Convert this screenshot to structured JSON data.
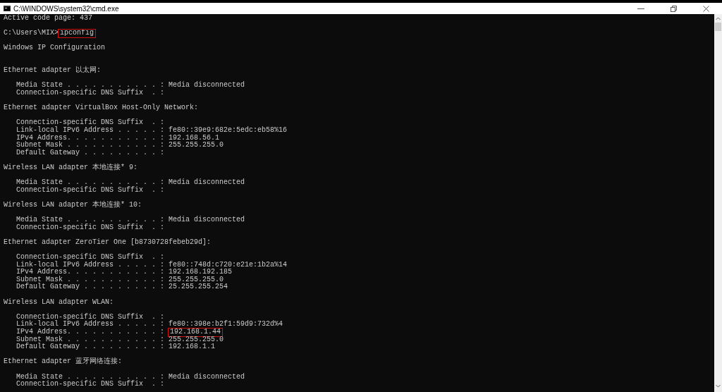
{
  "window": {
    "title": "C:\\WINDOWS\\system32\\cmd.exe"
  },
  "lines": [
    {
      "kind": "text",
      "parts": [
        {
          "text": "Active code page: 437",
          "boxed": false
        }
      ]
    },
    {
      "kind": "blank"
    },
    {
      "kind": "text",
      "parts": [
        {
          "text": "C:\\Users\\MIX>",
          "boxed": false
        },
        {
          "text": "ipconfig",
          "boxed": true
        }
      ]
    },
    {
      "kind": "blank"
    },
    {
      "kind": "text",
      "parts": [
        {
          "text": "Windows IP Configuration",
          "boxed": false
        }
      ]
    },
    {
      "kind": "blank"
    },
    {
      "kind": "blank"
    },
    {
      "kind": "text",
      "parts": [
        {
          "text": "Ethernet adapter 以太网:",
          "boxed": false
        }
      ]
    },
    {
      "kind": "blank"
    },
    {
      "kind": "text",
      "parts": [
        {
          "text": "   Media State . . . . . . . . . . . : Media disconnected",
          "boxed": false
        }
      ]
    },
    {
      "kind": "text",
      "parts": [
        {
          "text": "   Connection-specific DNS Suffix  . :",
          "boxed": false
        }
      ]
    },
    {
      "kind": "blank"
    },
    {
      "kind": "text",
      "parts": [
        {
          "text": "Ethernet adapter VirtualBox Host-Only Network:",
          "boxed": false
        }
      ]
    },
    {
      "kind": "blank"
    },
    {
      "kind": "text",
      "parts": [
        {
          "text": "   Connection-specific DNS Suffix  . :",
          "boxed": false
        }
      ]
    },
    {
      "kind": "text",
      "parts": [
        {
          "text": "   Link-local IPv6 Address . . . . . : fe80::39e9:682e:5edc:eb58%16",
          "boxed": false
        }
      ]
    },
    {
      "kind": "text",
      "parts": [
        {
          "text": "   IPv4 Address. . . . . . . . . . . : 192.168.56.1",
          "boxed": false
        }
      ]
    },
    {
      "kind": "text",
      "parts": [
        {
          "text": "   Subnet Mask . . . . . . . . . . . : 255.255.255.0",
          "boxed": false
        }
      ]
    },
    {
      "kind": "text",
      "parts": [
        {
          "text": "   Default Gateway . . . . . . . . . :",
          "boxed": false
        }
      ]
    },
    {
      "kind": "blank"
    },
    {
      "kind": "text",
      "parts": [
        {
          "text": "Wireless LAN adapter 本地连接* 9:",
          "boxed": false
        }
      ]
    },
    {
      "kind": "blank"
    },
    {
      "kind": "text",
      "parts": [
        {
          "text": "   Media State . . . . . . . . . . . : Media disconnected",
          "boxed": false
        }
      ]
    },
    {
      "kind": "text",
      "parts": [
        {
          "text": "   Connection-specific DNS Suffix  . :",
          "boxed": false
        }
      ]
    },
    {
      "kind": "blank"
    },
    {
      "kind": "text",
      "parts": [
        {
          "text": "Wireless LAN adapter 本地连接* 10:",
          "boxed": false
        }
      ]
    },
    {
      "kind": "blank"
    },
    {
      "kind": "text",
      "parts": [
        {
          "text": "   Media State . . . . . . . . . . . : Media disconnected",
          "boxed": false
        }
      ]
    },
    {
      "kind": "text",
      "parts": [
        {
          "text": "   Connection-specific DNS Suffix  . :",
          "boxed": false
        }
      ]
    },
    {
      "kind": "blank"
    },
    {
      "kind": "text",
      "parts": [
        {
          "text": "Ethernet adapter ZeroTier One [b8730728febeb29d]:",
          "boxed": false
        }
      ]
    },
    {
      "kind": "blank"
    },
    {
      "kind": "text",
      "parts": [
        {
          "text": "   Connection-specific DNS Suffix  . :",
          "boxed": false
        }
      ]
    },
    {
      "kind": "text",
      "parts": [
        {
          "text": "   Link-local IPv6 Address . . . . . : fe80::748d:c720:e21e:1b2a%14",
          "boxed": false
        }
      ]
    },
    {
      "kind": "text",
      "parts": [
        {
          "text": "   IPv4 Address. . . . . . . . . . . : 192.168.192.185",
          "boxed": false
        }
      ]
    },
    {
      "kind": "text",
      "parts": [
        {
          "text": "   Subnet Mask . . . . . . . . . . . : 255.255.255.0",
          "boxed": false
        }
      ]
    },
    {
      "kind": "text",
      "parts": [
        {
          "text": "   Default Gateway . . . . . . . . . : 25.255.255.254",
          "boxed": false
        }
      ]
    },
    {
      "kind": "blank"
    },
    {
      "kind": "text",
      "parts": [
        {
          "text": "Wireless LAN adapter WLAN:",
          "boxed": false
        }
      ]
    },
    {
      "kind": "blank"
    },
    {
      "kind": "text",
      "parts": [
        {
          "text": "   Connection-specific DNS Suffix  . :",
          "boxed": false
        }
      ]
    },
    {
      "kind": "text",
      "parts": [
        {
          "text": "   Link-local IPv6 Address . . . . . : fe80::398e:b2f1:59d9:732d%4",
          "boxed": false
        }
      ]
    },
    {
      "kind": "text",
      "parts": [
        {
          "text": "   IPv4 Address. . . . . . . . . . . : ",
          "boxed": false
        },
        {
          "text": "192.168.1.44",
          "boxed": true
        }
      ]
    },
    {
      "kind": "text",
      "parts": [
        {
          "text": "   Subnet Mask . . . . . . . . . . . : 255.255.255.0",
          "boxed": false
        }
      ]
    },
    {
      "kind": "text",
      "parts": [
        {
          "text": "   Default Gateway . . . . . . . . . : 192.168.1.1",
          "boxed": false
        }
      ]
    },
    {
      "kind": "blank"
    },
    {
      "kind": "text",
      "parts": [
        {
          "text": "Ethernet adapter 蓝牙网络连接:",
          "boxed": false
        }
      ]
    },
    {
      "kind": "blank"
    },
    {
      "kind": "text",
      "parts": [
        {
          "text": "   Media State . . . . . . . . . . . : Media disconnected",
          "boxed": false
        }
      ]
    },
    {
      "kind": "text",
      "parts": [
        {
          "text": "   Connection-specific DNS Suffix  . :",
          "boxed": false
        }
      ]
    }
  ]
}
